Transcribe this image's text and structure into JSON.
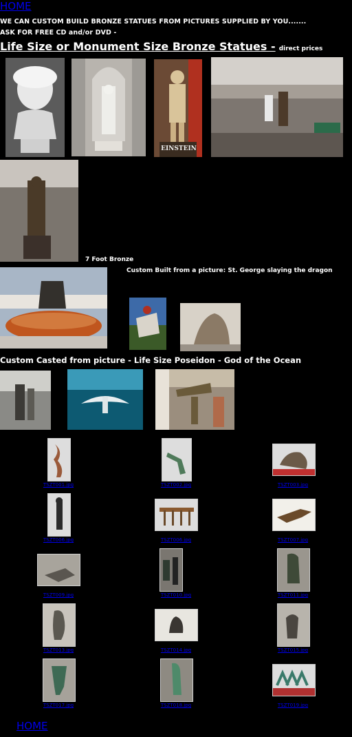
{
  "nav": {
    "home_top": "HOME",
    "home_bottom": "HOME"
  },
  "intro": {
    "line1": "WE CAN CUSTOM BUILD BRONZE STATUES FROM PICTURES SUPPLIED BY YOU.......",
    "line2": "ASK FOR FREE CD and/or DVD -"
  },
  "heading": {
    "main": "Life Size or Monument Size Bronze Statues -",
    "small": "direct prices"
  },
  "captions": {
    "seven_foot": "7 Foot  Bronze",
    "st_george": "Custom Built from a picture: St. George slaying the dragon",
    "einstein_plinth": "EINSTEIN",
    "poseidon": "Custom Casted from picture - Life Size Poseidon - God of the Ocean"
  },
  "gallery": [
    {
      "label": "TSZT001.jpg"
    },
    {
      "label": "TSZT002.jpg"
    },
    {
      "label": "TSZT003.jpg"
    },
    {
      "label": "TSZT006.jpg"
    },
    {
      "label": "TSZT006.jpg"
    },
    {
      "label": "TSZT007.jpg"
    },
    {
      "label": "TSZT009.jpg"
    },
    {
      "label": "TSZT010.jpg"
    },
    {
      "label": "TSZT011.jpg"
    },
    {
      "label": "TSZT013.jpg"
    },
    {
      "label": "TSZT014.jpg"
    },
    {
      "label": "TSZT015.jpg"
    },
    {
      "label": "TSZT017.jpg"
    },
    {
      "label": "TSZT018.jpg"
    },
    {
      "label": "TSZT019.jpg"
    }
  ],
  "colors": {
    "background": "#000000",
    "link": "#0000ee",
    "text": "#ffffff"
  }
}
